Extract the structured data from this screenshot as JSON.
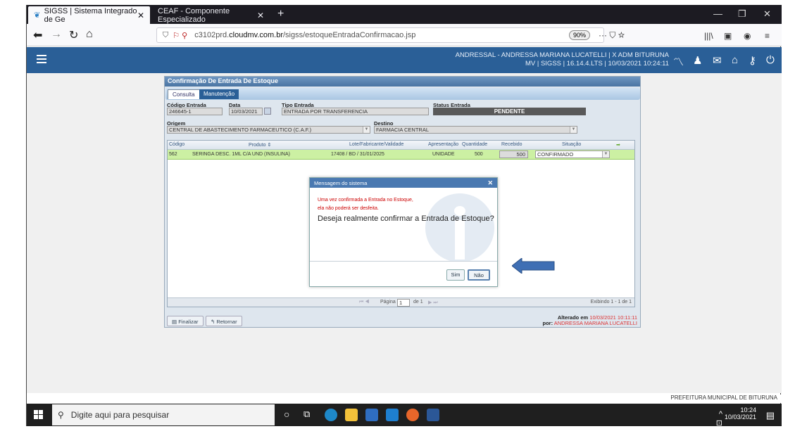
{
  "browser": {
    "tabs": [
      {
        "title": "SIGSS | Sistema Integrado de Ge",
        "active": true
      },
      {
        "title": "CEAF - Componente Especializado",
        "active": false
      }
    ],
    "url_prefix": "c3102prd.",
    "url_domain": "cloudmv.com.br",
    "url_path": "/sigss/estoqueEntradaConfirmacao.jsp",
    "zoom": "90%"
  },
  "header": {
    "user_line1": "ANDRESSAL - ANDRESSA MARIANA LUCATELLI  |  X ADM BITURUNA",
    "user_line2": "MV  |  SIGSS  |  16.14.4.LTS  |  10/03/2021 10:24:11"
  },
  "panel": {
    "title": "Confirmação De Entrada De Estoque",
    "tabs": [
      "Consulta",
      "Manutenção"
    ],
    "fields": {
      "codigo_entrada_label": "Código Entrada",
      "codigo_entrada": "246645-1",
      "data_label": "Data",
      "data": "10/03/2021",
      "tipo_entrada_label": "Tipo Entrada",
      "tipo_entrada": "ENTRADA POR TRANSFERENCIA",
      "status_label": "Status Entrada",
      "status": "PENDENTE",
      "origem_label": "Origem",
      "origem": "CENTRAL DE ABASTECIMENTO FARMACEUTICO (C.A.F.)",
      "destino_label": "Destino",
      "destino": "FARMACIA CENTRAL"
    },
    "grid": {
      "headers": [
        "Código",
        "Produto",
        "Lote/Fabricante/Validade",
        "Apresentação",
        "Quantidade",
        "Recebido",
        "Situação"
      ],
      "row": {
        "codigo": "562",
        "produto": "SERINGA DESC. 1ML C/A UND (INSULINA)",
        "lote": "17408 / BD / 31/01/2025",
        "apresentacao": "UNIDADE",
        "quantidade": "500",
        "recebido": "500",
        "situacao": "CONFIRMADO"
      },
      "pager": {
        "pagina_label": "Página",
        "page": "1",
        "of": "de 1",
        "exibindo": "Exibindo 1 - 1 de 1"
      }
    },
    "buttons": {
      "finalizar": "Finalizar",
      "retornar": "Retornar"
    },
    "alterado": {
      "label": "Alterado em",
      "when": "10/03/2021 10:11:11",
      "por_label": "por:",
      "por": "ANDRESSA MARIANA LUCATELLI"
    }
  },
  "dialog": {
    "title": "Mensagem do sistema",
    "warning1": "Uma vez confirmada a Entrada no Estoque,",
    "warning2": "ela não poderá ser desfeita.",
    "question": "Deseja realmente confirmar a Entrada de Estoque?",
    "yes": "Sim",
    "no": "Não"
  },
  "footer": {
    "text": "PREFEITURA MUNICIPAL DE BITURUNA"
  },
  "taskbar": {
    "search_placeholder": "Digite aqui para pesquisar",
    "time": "10:24",
    "date": "10/03/2021"
  },
  "colors": {
    "header": "#2a5f97",
    "grid_row": "#ccf0a3",
    "status": "#595959",
    "arrow": "#3f6fb4"
  }
}
